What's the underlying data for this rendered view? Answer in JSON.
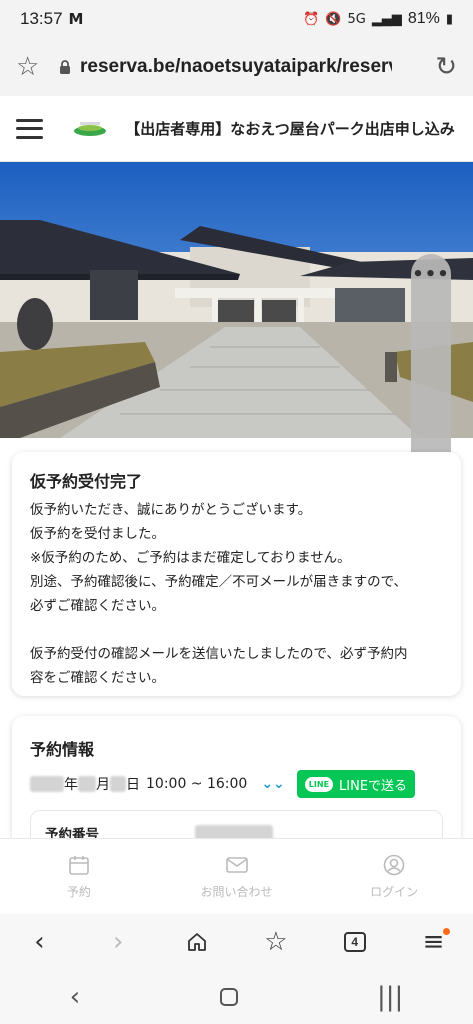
{
  "status_bar": {
    "time": "13:57",
    "battery": "81%",
    "network": "5G"
  },
  "browser": {
    "url": "reserva.be/naoetsuyataipark/reserv"
  },
  "header": {
    "title": "【出店者専用】なおえつ屋台パーク出店申し込み"
  },
  "confirmation": {
    "title": "仮予約受付完了",
    "lines": [
      "仮予約いただき、誠にありがとうございます。",
      "仮予約を受付ました。",
      "※仮予約のため、ご予約はまだ確定しておりません。",
      "別途、予約確認後に、予約確定／不可メールが届きますので、",
      "必ずご確認ください。",
      "仮予約受付の確認メールを送信いたしましたので、必ず予約内",
      "容をご確認ください。"
    ]
  },
  "reservation": {
    "title": "予約情報",
    "year_unit": "年",
    "month_unit": "月",
    "day_unit": "日",
    "time_range": "10:00 ~ 16:00",
    "line_button": "LINEで送る",
    "line_logo": "LINE",
    "number_label": "予約番号"
  },
  "site_nav": {
    "items": [
      {
        "label": "予約",
        "icon": "calendar-icon"
      },
      {
        "label": "お問い合わせ",
        "icon": "mail-icon"
      },
      {
        "label": "ログイン",
        "icon": "user-icon"
      }
    ]
  },
  "browser_toolbar": {
    "tabs_count": "4"
  },
  "colors": {
    "line_green": "#06c755",
    "accent_blue": "#1e9bd0",
    "badge_orange": "#ff6a1a"
  }
}
